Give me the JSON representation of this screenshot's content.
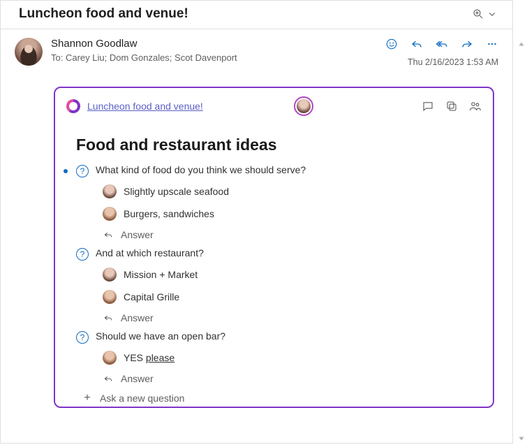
{
  "subject": "Luncheon food and venue!",
  "sender": {
    "name": "Shannon Goodlaw"
  },
  "recipients": {
    "label": "To:",
    "list": "Carey Liu;  Dom Gonzales;  Scot Davenport"
  },
  "timestamp": "Thu 2/16/2023 1:53 AM",
  "loop": {
    "title": "Luncheon food and venue!",
    "heading": "Food and restaurant ideas",
    "questions": [
      {
        "text": "What kind of food do you think we should serve?",
        "has_bullet": true,
        "answers": [
          {
            "text": "Slightly upscale seafood",
            "avatar": "a"
          },
          {
            "text": "Burgers, sandwiches",
            "avatar": "b"
          }
        ]
      },
      {
        "text": "And at which restaurant?",
        "has_bullet": false,
        "answers": [
          {
            "text": "Mission + Market",
            "avatar": "a"
          },
          {
            "text": "Capital Grille",
            "avatar": "b"
          }
        ]
      },
      {
        "text": "Should we have an open bar?",
        "has_bullet": false,
        "answers": [
          {
            "text_prefix": "YES ",
            "text_ul": "please",
            "avatar": "b"
          }
        ]
      }
    ],
    "answer_label": "Answer",
    "ask_label": "Ask a new question"
  }
}
